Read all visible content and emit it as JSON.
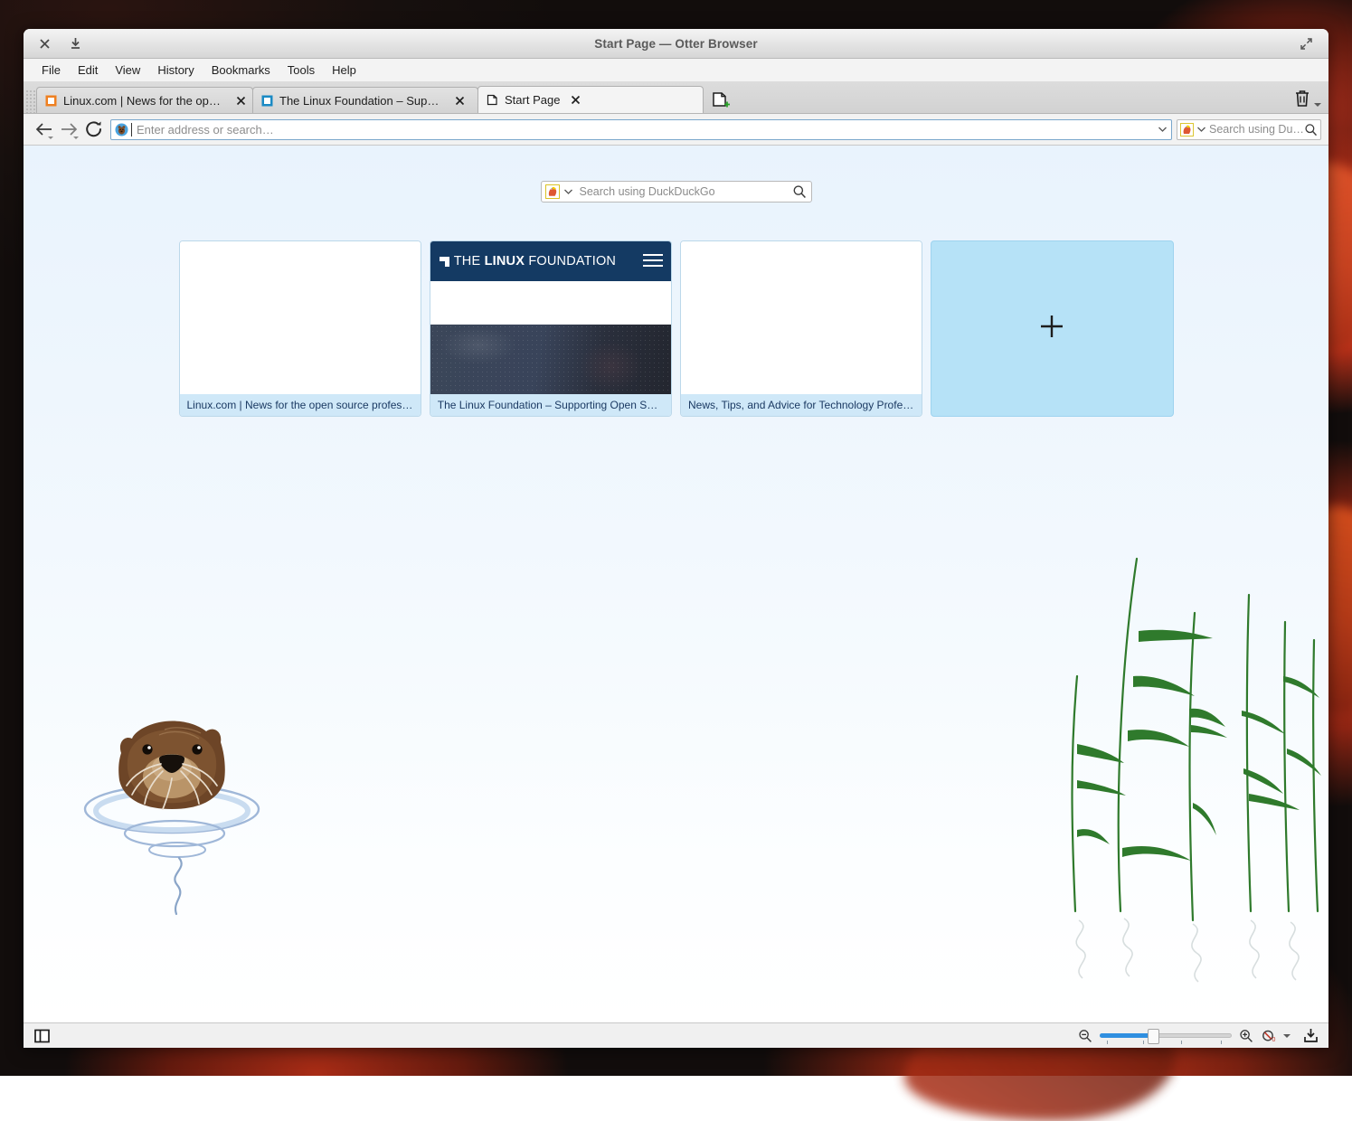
{
  "window": {
    "title": "Start Page — Otter Browser",
    "close_icon": "close-icon",
    "download_icon": "download-icon",
    "maximize_icon": "maximize-icon"
  },
  "menubar": {
    "items": [
      {
        "label": "File"
      },
      {
        "label": "Edit"
      },
      {
        "label": "View"
      },
      {
        "label": "History"
      },
      {
        "label": "Bookmarks"
      },
      {
        "label": "Tools"
      },
      {
        "label": "Help"
      }
    ]
  },
  "tabs": {
    "items": [
      {
        "title": "Linux.com | News for the open sou…",
        "favicon_color": "#ef8021",
        "active": false
      },
      {
        "title": "The Linux Foundation – Supportin…",
        "favicon_color": "#1a8ac4",
        "active": false
      },
      {
        "title": "Start Page",
        "favicon_color": "#ffffff",
        "active": true
      }
    ],
    "new_tab_label": "",
    "trash_label": ""
  },
  "toolbar": {
    "back_label": "",
    "forward_label": "",
    "reload_label": "",
    "address_placeholder": "Enter address or search…",
    "address_value": "",
    "search_placeholder": "Search using Du…",
    "search_engine": "DuckDuckGo"
  },
  "startpage": {
    "search_placeholder": "Search using DuckDuckGo",
    "tiles": [
      {
        "title": "Linux.com | News for the open source profes…",
        "type": "blank"
      },
      {
        "title": "The Linux Foundation – Supporting Open S…",
        "type": "linux-foundation"
      },
      {
        "title": "News, Tips, and Advice for Technology Profe…",
        "type": "blank"
      }
    ],
    "add_tile_label": "+",
    "linux_foundation": {
      "logo_the": "THE ",
      "logo_linux": "LINUX",
      "logo_foundation": " FOUNDATION"
    }
  },
  "statusbar": {
    "sidebar_toggle_label": "",
    "zoom_out_label": "",
    "zoom_in_label": "",
    "zoom_percent": 40,
    "content_blocking_label": "",
    "downloads_label": ""
  },
  "colors": {
    "accent": "#2f8fe0",
    "tile_caption_bg": "#cfe8f8",
    "tile_caption_text": "#1b3a63",
    "lf_navy": "#143a63",
    "add_tile_bg": "#b6e2f7"
  }
}
